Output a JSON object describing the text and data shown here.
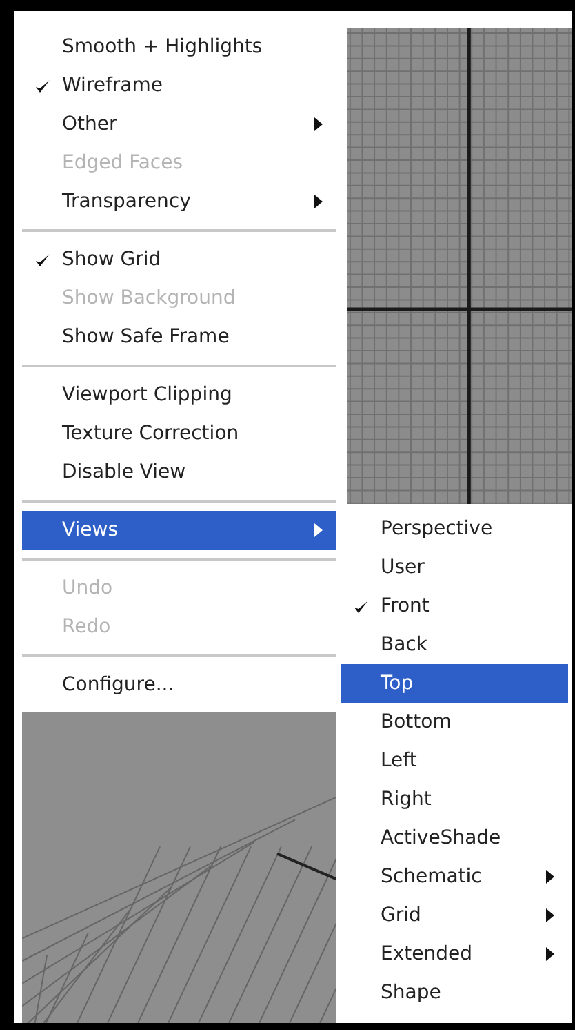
{
  "main_menu": {
    "items": [
      {
        "kind": "item",
        "label": "Smooth + Highlights",
        "checked": false,
        "disabled": false,
        "submenu": false,
        "selected": false
      },
      {
        "kind": "item",
        "label": "Wireframe",
        "checked": true,
        "disabled": false,
        "submenu": false,
        "selected": false
      },
      {
        "kind": "item",
        "label": "Other",
        "checked": false,
        "disabled": false,
        "submenu": true,
        "selected": false
      },
      {
        "kind": "item",
        "label": "Edged Faces",
        "checked": false,
        "disabled": true,
        "submenu": false,
        "selected": false
      },
      {
        "kind": "item",
        "label": "Transparency",
        "checked": false,
        "disabled": false,
        "submenu": true,
        "selected": false
      },
      {
        "kind": "separator"
      },
      {
        "kind": "item",
        "label": "Show Grid",
        "checked": true,
        "disabled": false,
        "submenu": false,
        "selected": false
      },
      {
        "kind": "item",
        "label": "Show Background",
        "checked": false,
        "disabled": true,
        "submenu": false,
        "selected": false
      },
      {
        "kind": "item",
        "label": "Show Safe Frame",
        "checked": false,
        "disabled": false,
        "submenu": false,
        "selected": false
      },
      {
        "kind": "separator"
      },
      {
        "kind": "item",
        "label": "Viewport Clipping",
        "checked": false,
        "disabled": false,
        "submenu": false,
        "selected": false
      },
      {
        "kind": "item",
        "label": "Texture Correction",
        "checked": false,
        "disabled": false,
        "submenu": false,
        "selected": false
      },
      {
        "kind": "item",
        "label": "Disable View",
        "checked": false,
        "disabled": false,
        "submenu": false,
        "selected": false
      },
      {
        "kind": "separator"
      },
      {
        "kind": "item",
        "label": "Views",
        "checked": false,
        "disabled": false,
        "submenu": true,
        "selected": true
      },
      {
        "kind": "separator"
      },
      {
        "kind": "item",
        "label": "Undo",
        "checked": false,
        "disabled": true,
        "submenu": false,
        "selected": false
      },
      {
        "kind": "item",
        "label": "Redo",
        "checked": false,
        "disabled": true,
        "submenu": false,
        "selected": false
      },
      {
        "kind": "separator"
      },
      {
        "kind": "item",
        "label": "Configure...",
        "checked": false,
        "disabled": false,
        "submenu": false,
        "selected": false
      }
    ]
  },
  "views_submenu": {
    "items": [
      {
        "kind": "item",
        "label": "Perspective",
        "checked": false,
        "disabled": false,
        "submenu": false,
        "selected": false
      },
      {
        "kind": "item",
        "label": "User",
        "checked": false,
        "disabled": false,
        "submenu": false,
        "selected": false
      },
      {
        "kind": "item",
        "label": "Front",
        "checked": true,
        "disabled": false,
        "submenu": false,
        "selected": false
      },
      {
        "kind": "item",
        "label": "Back",
        "checked": false,
        "disabled": false,
        "submenu": false,
        "selected": false
      },
      {
        "kind": "item",
        "label": "Top",
        "checked": false,
        "disabled": false,
        "submenu": false,
        "selected": true
      },
      {
        "kind": "item",
        "label": "Bottom",
        "checked": false,
        "disabled": false,
        "submenu": false,
        "selected": false
      },
      {
        "kind": "item",
        "label": "Left",
        "checked": false,
        "disabled": false,
        "submenu": false,
        "selected": false
      },
      {
        "kind": "item",
        "label": "Right",
        "checked": false,
        "disabled": false,
        "submenu": false,
        "selected": false
      },
      {
        "kind": "item",
        "label": "ActiveShade",
        "checked": false,
        "disabled": false,
        "submenu": false,
        "selected": false
      },
      {
        "kind": "item",
        "label": "Schematic",
        "checked": false,
        "disabled": false,
        "submenu": true,
        "selected": false
      },
      {
        "kind": "item",
        "label": "Grid",
        "checked": false,
        "disabled": false,
        "submenu": true,
        "selected": false
      },
      {
        "kind": "item",
        "label": "Extended",
        "checked": false,
        "disabled": false,
        "submenu": true,
        "selected": false
      },
      {
        "kind": "item",
        "label": "Shape",
        "checked": false,
        "disabled": false,
        "submenu": false,
        "selected": false
      }
    ]
  }
}
